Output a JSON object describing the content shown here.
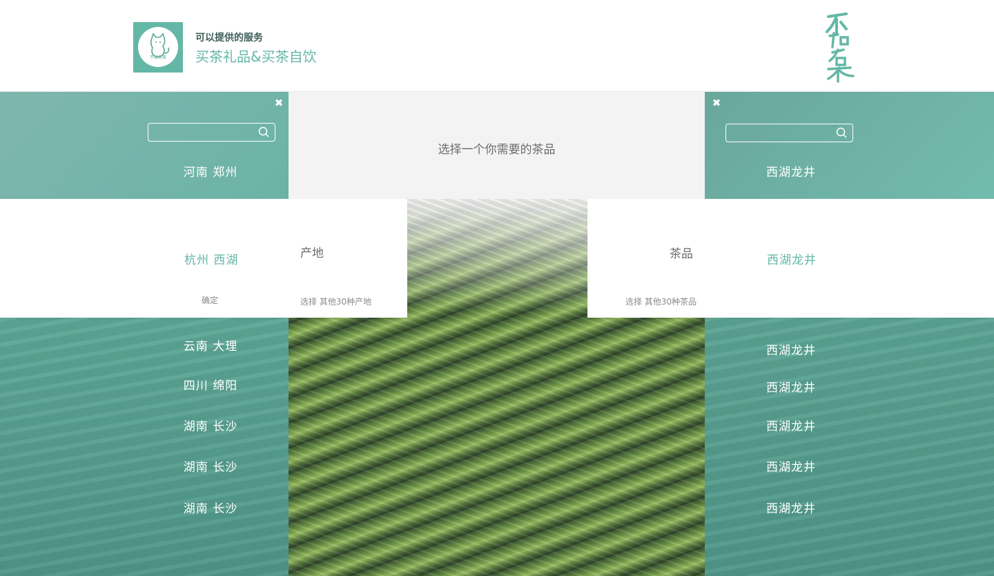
{
  "header": {
    "subtitle": "可以提供的服务",
    "title": "买茶礼品&买茶自饮",
    "logo_text": "不知名茶"
  },
  "left_panel": {
    "search_placeholder": "",
    "top_item": "河南 郑州",
    "selected_item": "杭州 西湖",
    "confirm_label": "确定",
    "items": [
      "云南 大理",
      "四川 绵阳",
      "湖南 长沙",
      "湖南 长沙",
      "湖南 长沙"
    ]
  },
  "origin_card": {
    "label": "产地",
    "more_link": "选择 其他30种产地"
  },
  "center": {
    "prompt": "选择一个你需要的茶品"
  },
  "tea_card": {
    "label": "茶品",
    "more_link": "选择 其他30种茶品"
  },
  "right_panel": {
    "search_placeholder": "",
    "top_item": "西湖龙井",
    "selected_item": "西湖龙井",
    "items": [
      "西湖龙井",
      "西湖龙井",
      "西湖龙井",
      "西湖龙井",
      "西湖龙井"
    ]
  },
  "colors": {
    "accent": "#64b7a6",
    "panel_top": "#6bb3a6",
    "panel_bottom": "#4f9688",
    "center_bg": "#f3f3f3"
  }
}
